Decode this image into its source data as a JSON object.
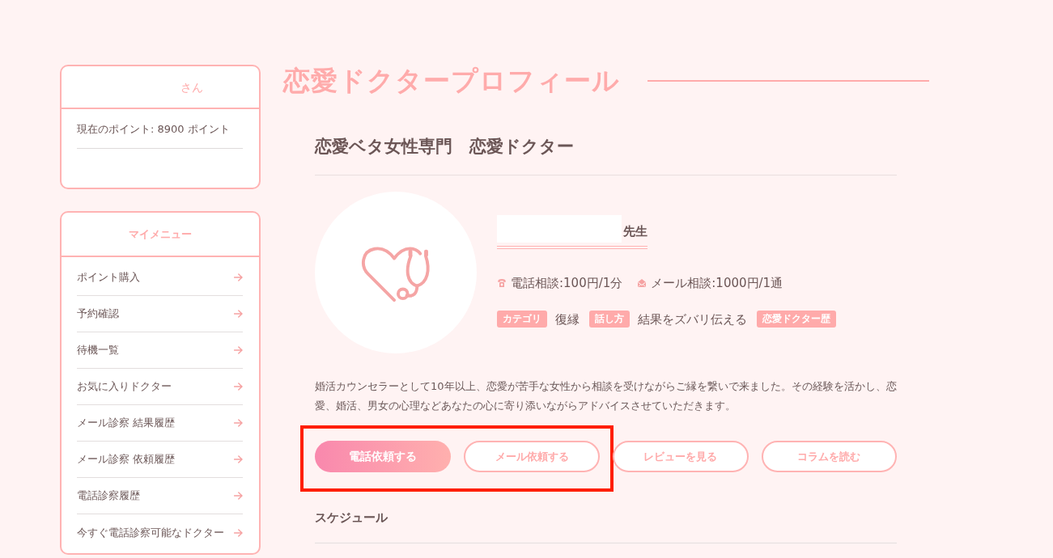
{
  "sidebar": {
    "user_card": {
      "name_suffix": "さん",
      "points": "現在のポイント: 8900 ポイント"
    },
    "menu": {
      "title": "マイメニュー",
      "items": [
        {
          "label": "ポイント購入"
        },
        {
          "label": "予約確認"
        },
        {
          "label": "待機一覧"
        },
        {
          "label": "お気に入りドクター"
        },
        {
          "label": "メール診察 結果履歴"
        },
        {
          "label": "メール診察 依頼履歴"
        },
        {
          "label": "電話診察履歴"
        },
        {
          "label": "今すぐ電話診察可能なドクター"
        }
      ]
    }
  },
  "page_title": "恋愛ドクタープロフィール",
  "profile": {
    "headline": "恋愛ベタ女性専門　恋愛ドクター",
    "honorific": "先生",
    "prices": [
      {
        "kind": "phone",
        "text": "電話相談:100円/1分"
      },
      {
        "kind": "mail",
        "text": "メール相談:1000円/1通"
      }
    ],
    "attributes": [
      {
        "label": "カテゴリ",
        "value": "復縁"
      },
      {
        "label": "話し方",
        "value": "結果をズバリ伝える"
      },
      {
        "label": "恋愛ドクター歴"
      }
    ],
    "description": "婚活カウンセラーとして10年以上、恋愛が苦手な女性から相談を受けながらご縁を繋いで来ました。その経験を活かし、恋愛、婚活、男女の心理などあなたの心に寄り添いながらアドバイスさせていただきます。",
    "action_buttons": [
      {
        "label": "電話依頼する",
        "kind": "filled",
        "highlighted": true
      },
      {
        "label": "メール依頼する",
        "kind": "outline",
        "highlighted": true
      },
      {
        "label": "レビューを見る",
        "kind": "outline",
        "highlighted": false
      },
      {
        "label": "コラムを読む",
        "kind": "outline",
        "highlighted": false
      }
    ],
    "schedule_heading": "スケジュール"
  }
}
